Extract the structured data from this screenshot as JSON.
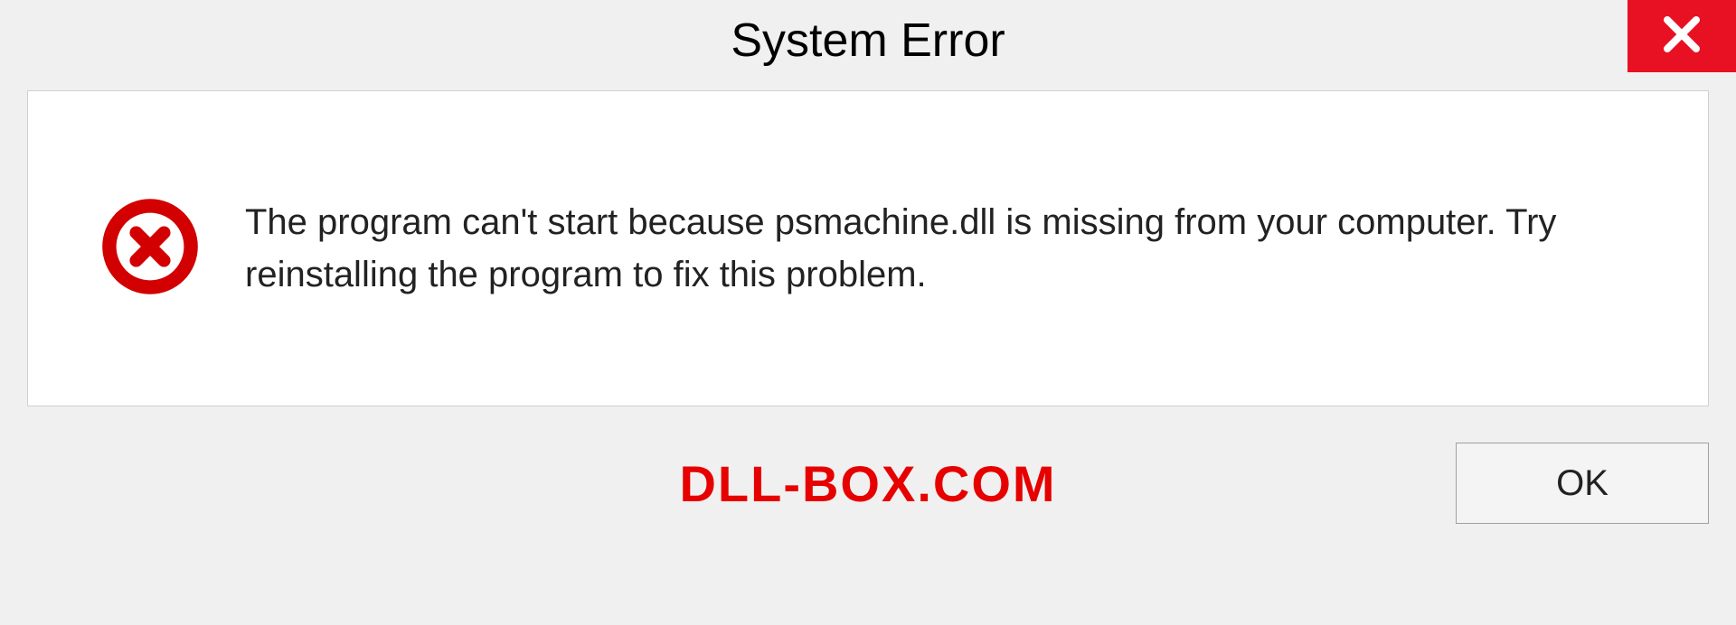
{
  "dialog": {
    "title": "System Error",
    "message": "The program can't start because psmachine.dll is missing from your computer. Try reinstalling the program to fix this problem.",
    "ok_label": "OK"
  },
  "watermark": "DLL-BOX.COM",
  "colors": {
    "close_bg": "#e81123",
    "error_icon": "#d20000",
    "watermark": "#e60000"
  }
}
